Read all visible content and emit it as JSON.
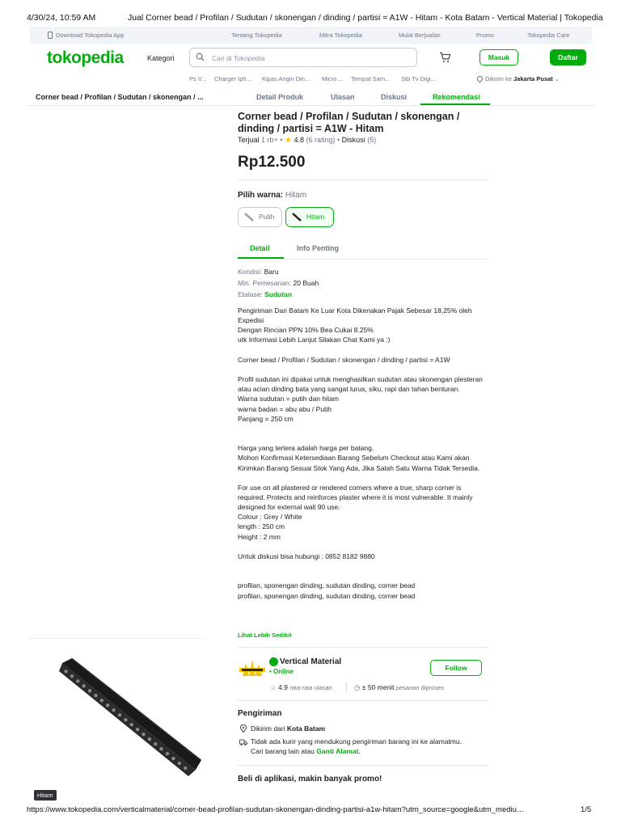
{
  "print": {
    "datetime": "4/30/24, 10:59 AM",
    "title": "Jual Corner bead / Profilan / Sudutan / skonengan / dinding / partisi = A1W - Hitam - Kota Batam - Vertical Material | Tokopedia",
    "url": "https://www.tokopedia.com/verticalmaterial/corner-bead-profilan-sudutan-skonengan-dinding-partisi-a1w-hitam?utm_source=google&utm_mediu…",
    "page": "1/5"
  },
  "topbar": {
    "download": "Download Tokopedia App",
    "links": [
      "Tentang Tokopedia",
      "Mitra Tokopedia",
      "Mulai Berjualan",
      "Promo",
      "Tokopedia Care"
    ]
  },
  "header": {
    "logo": "tokopedia",
    "kategori": "Kategori",
    "search_placeholder": "Cari di Tokopedia",
    "masuk": "Masuk",
    "daftar": "Daftar",
    "suggestions": [
      "Ps V...",
      "Charger Iph...",
      "Kipas Angin Din...",
      "Micro ...",
      "Tempat Sam...",
      "Stb Tv Digi..."
    ],
    "location_prefix": "Dikirim ke",
    "location_value": "Jakarta Pusat"
  },
  "tabbar": {
    "title": "Corner bead / Profilan / Sudutan / skonengan / ...",
    "tabs": [
      "Detail Produk",
      "Ulasan",
      "Diskusi",
      "Rekomendasi"
    ],
    "active": "Rekomendasi"
  },
  "product": {
    "title": "Corner bead / Profilan / Sudutan / skonengan / dinding / partisi = A1W - Hitam",
    "sold": "Terjual",
    "sold_count": "1 rb+",
    "rating": "4.8",
    "rating_count": "(6 rating)",
    "discussion": "Diskusi",
    "discussion_count": "(5)",
    "price": "Rp12.500",
    "variant_label": "Pilih warna:",
    "variant_value": "Hitam",
    "variants": [
      "Putih",
      "Hitam"
    ],
    "selected_variant": "Hitam"
  },
  "detail_tabs": [
    "Detail",
    "Info Penting"
  ],
  "specs": {
    "kondisi_k": "Kondisi:",
    "kondisi_v": "Baru",
    "min_k": "Min. Pemesanan:",
    "min_v": "20 Buah",
    "etalase_k": "Etalase:",
    "etalase_v": "Sudutan"
  },
  "description": [
    "Pengiriman Dari Batam Ke Luar Kota Dikenakan Pajak Sebesar 18,25% oleh Expedisi",
    "Dengan Rincian PPN 10% Bea Cukai 8.25%",
    "utk Informasi Lebih Lanjut Silakan Chat Kami ya :)",
    "",
    "Corner bead / Profilan / Sudutan / skonengan / dinding / partisi = A1W",
    "",
    "Profil sudutan ini dipakai untuk menghasilkan sudutan atau skonengan plesteran atau acian dinding bata yang sangat lurus, siku, rapi dan tahan benturan.",
    "Warna sudutan = putih dan hitam",
    "warna badan = abu abu / Putih",
    "Panjang = 250 cm",
    "",
    "",
    "Harga yang tertera adalah harga per batang.",
    "Mohon Konfirmasi Ketersediaan Barang Sebelum Checkout atau Kami akan Kirimkan Barang Sesuai Stok Yang Ada, Jika Salah Satu Warna Tidak Tersedia.",
    "",
    "For use on all plastered or rendered corners where a true, sharp corner is required. Protects and reinforces plaster where it is most vulnerable. It mainly designed for external wall 90 use.",
    "Colour : Grey / White",
    "length : 250 cm",
    "Height : 2 mm",
    "",
    "Untuk diskusi bisa hubungi : 0852 8182 9880",
    "",
    "",
    "profilan, sponengan dinding, sudutan dinding, corner bead",
    "profilan, sponengan dinding, sudutan dinding, corner bead"
  ],
  "see_less": "Lihat Lebih Sedikit",
  "shop": {
    "name": "Vertical Material",
    "status": "• Online",
    "follow": "Follow",
    "rating": "4.9",
    "rating_label": "rata-rata ulasan",
    "response": "± 50 menit",
    "response_label": "pesanan diproses"
  },
  "shipping": {
    "title": "Pengiriman",
    "from_prefix": "Dikirim dari",
    "from_city": "Kota Batam",
    "notice": "Tidak ada kurir yang mendukung pengiriman barang ini ke alamatmu. Cari barang lain atau",
    "notice_link": "Ganti Alamat",
    "notice_end": "."
  },
  "promo": "Beli di aplikasi, makin banyak promo!",
  "image_label": "Hitam",
  "colors": {
    "brand": "#03ac0e",
    "text": "#212121",
    "muted": "#6d7588"
  }
}
